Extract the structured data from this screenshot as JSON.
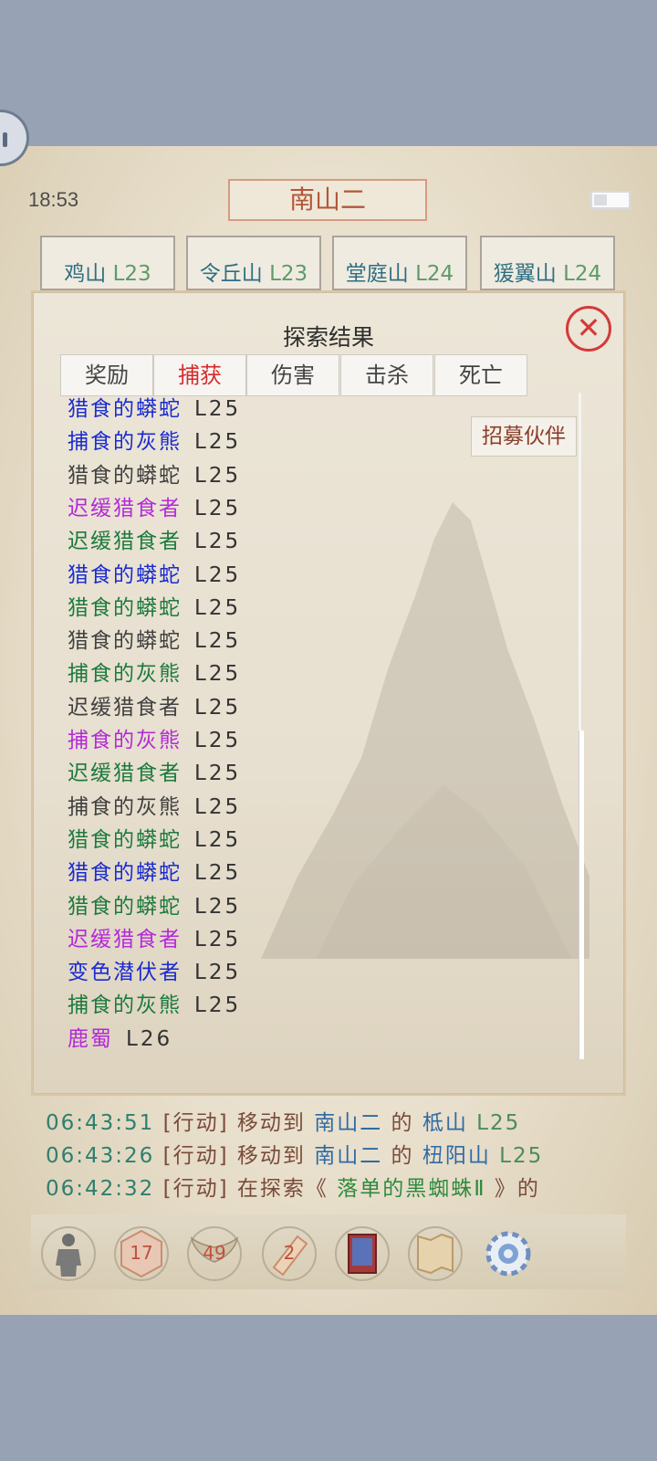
{
  "status": {
    "time": "18:53"
  },
  "header": {
    "title": "南山二"
  },
  "map_tabs": [
    {
      "name": "鸡山",
      "level": "L23"
    },
    {
      "name": "令丘山",
      "level": "L23"
    },
    {
      "name": "堂庭山",
      "level": "L24"
    },
    {
      "name": "猨翼山",
      "level": "L24"
    }
  ],
  "panel": {
    "title": "探索结果",
    "tabs": [
      "奖励",
      "捕获",
      "伤害",
      "击杀",
      "死亡"
    ],
    "active_tab": "捕获",
    "recruit_label": "招募伙伴",
    "captures": [
      {
        "name": "猎食的蟒蛇",
        "level": "L25",
        "color": "#1a2bd0"
      },
      {
        "name": "捕食的灰熊",
        "level": "L25",
        "color": "#1a2bd0"
      },
      {
        "name": "猎食的蟒蛇",
        "level": "L25",
        "color": "#404040"
      },
      {
        "name": "迟缓猎食者",
        "level": "L25",
        "color": "#b42ad8"
      },
      {
        "name": "迟缓猎食者",
        "level": "L25",
        "color": "#1c7a3d"
      },
      {
        "name": "猎食的蟒蛇",
        "level": "L25",
        "color": "#1a2bd0"
      },
      {
        "name": "猎食的蟒蛇",
        "level": "L25",
        "color": "#1c7a3d"
      },
      {
        "name": "猎食的蟒蛇",
        "level": "L25",
        "color": "#404040"
      },
      {
        "name": "捕食的灰熊",
        "level": "L25",
        "color": "#1c7a3d"
      },
      {
        "name": "迟缓猎食者",
        "level": "L25",
        "color": "#404040"
      },
      {
        "name": "捕食的灰熊",
        "level": "L25",
        "color": "#b42ad8"
      },
      {
        "name": "迟缓猎食者",
        "level": "L25",
        "color": "#1c7a3d"
      },
      {
        "name": "捕食的灰熊",
        "level": "L25",
        "color": "#404040"
      },
      {
        "name": "猎食的蟒蛇",
        "level": "L25",
        "color": "#1c7a3d"
      },
      {
        "name": "猎食的蟒蛇",
        "level": "L25",
        "color": "#1a2bd0"
      },
      {
        "name": "猎食的蟒蛇",
        "level": "L25",
        "color": "#1c7a3d"
      },
      {
        "name": "迟缓猎食者",
        "level": "L25",
        "color": "#b42ad8"
      },
      {
        "name": "变色潜伏者",
        "level": "L25",
        "color": "#1a2bd0"
      },
      {
        "name": "捕食的灰熊",
        "level": "L25",
        "color": "#1c7a3d"
      },
      {
        "name": "鹿蜀",
        "level": "L26",
        "color": "#b42ad8"
      }
    ]
  },
  "log": [
    {
      "time": "06:43:51",
      "tag": "[行动]",
      "action": "移动到",
      "region": "南山二",
      "of": "的",
      "place": "柢山",
      "level": "L25"
    },
    {
      "time": "06:43:26",
      "tag": "[行动]",
      "action": "移动到",
      "region": "南山二",
      "of": "的",
      "place": "杻阳山",
      "level": "L25"
    },
    {
      "time": "06:42:32",
      "tag": "[行动]",
      "action": "在探索《",
      "quest": "落单的黑蜘蛛Ⅱ",
      "end": "》的"
    }
  ],
  "toolbar": {
    "character_icon": "character-icon",
    "dice_count": "17",
    "wings_count": "49",
    "scroll_count": "2",
    "book_icon": "book-icon",
    "map_icon": "map-icon",
    "settings_icon": "gear-icon"
  }
}
